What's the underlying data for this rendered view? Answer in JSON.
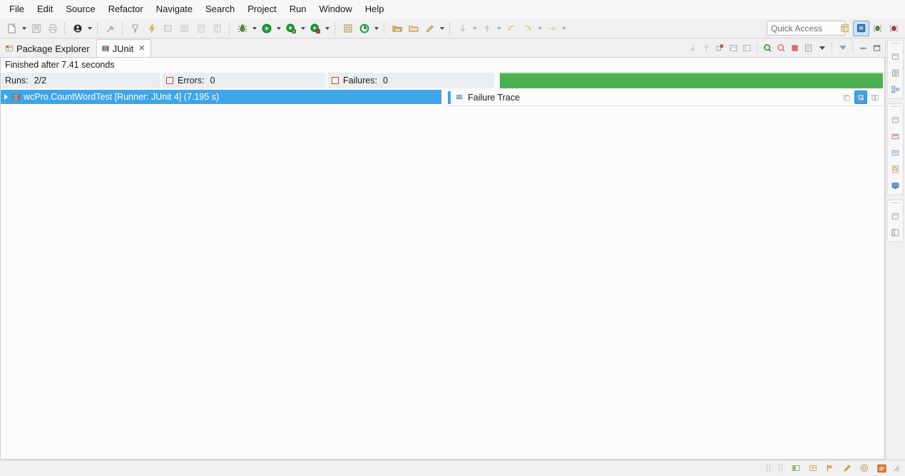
{
  "menubar": {
    "items": [
      {
        "label": "File",
        "name": "menu-file"
      },
      {
        "label": "Edit",
        "name": "menu-edit"
      },
      {
        "label": "Source",
        "name": "menu-source"
      },
      {
        "label": "Refactor",
        "name": "menu-refactor"
      },
      {
        "label": "Navigate",
        "name": "menu-navigate"
      },
      {
        "label": "Search",
        "name": "menu-search"
      },
      {
        "label": "Project",
        "name": "menu-project"
      },
      {
        "label": "Run",
        "name": "menu-run"
      },
      {
        "label": "Window",
        "name": "menu-window"
      },
      {
        "label": "Help",
        "name": "menu-help"
      }
    ]
  },
  "toolbar": {
    "quick_access_placeholder": "Quick Access",
    "icons": [
      "new-wizard-icon",
      "save-icon",
      "print-icon",
      "java-perspective-icon",
      "link-editor-icon",
      "new-annotation-icon",
      "build-icon",
      "external-tools-icon",
      "debug-icon",
      "run-icon",
      "run-as-icon",
      "coverage-icon",
      "new-java-class-icon",
      "new-java-package-icon",
      "open-type-icon",
      "search-icon",
      "open-task-icon",
      "bookmark-icon",
      "previous-annotation-icon",
      "next-annotation-icon",
      "back-icon",
      "forward-icon"
    ]
  },
  "perspective": {
    "items": [
      {
        "name": "open-perspective-icon",
        "active": false
      },
      {
        "name": "java-perspective-icon",
        "active": true
      },
      {
        "name": "debug-perspective-icon",
        "active": false
      },
      {
        "name": "java-ee-perspective-icon",
        "active": false
      }
    ]
  },
  "tabs": [
    {
      "label": "Package Explorer",
      "icon": "package-explorer-icon",
      "active": false,
      "closable": false
    },
    {
      "label": "JUnit",
      "icon": "junit-icon",
      "active": true,
      "closable": true,
      "close_glyph": "✕"
    }
  ],
  "view_toolbar": {
    "buttons": [
      {
        "name": "next-failed-test-icon",
        "title": "Next Failed Test"
      },
      {
        "name": "previous-failed-test-icon",
        "title": "Previous Failed Test"
      },
      {
        "name": "show-failures-only-icon",
        "title": "Show Failures Only"
      },
      {
        "name": "show-tests-in-hierarchy-icon",
        "title": "Show Tests in Hierarchy"
      },
      {
        "name": "scroll-lock-icon",
        "title": "Scroll Lock"
      },
      {
        "name": "rerun-test-icon",
        "title": "Rerun Test"
      },
      {
        "name": "rerun-failed-tests-icon",
        "title": "Rerun Test - Failures First"
      },
      {
        "name": "stop-test-run-icon",
        "title": "Stop JUnit Test Run"
      },
      {
        "name": "test-run-history-icon",
        "title": "Test Run History"
      },
      {
        "name": "view-menu-icon",
        "title": "View Menu"
      },
      {
        "name": "minimize-view-icon",
        "title": "Minimize"
      },
      {
        "name": "maximize-view-icon",
        "title": "Maximize"
      }
    ]
  },
  "junit": {
    "status_text": "Finished after 7.41 seconds",
    "counters": [
      {
        "name": "runs-counter",
        "label": "Runs:",
        "value": "2/2",
        "icon": null
      },
      {
        "name": "errors-counter",
        "label": "Errors:",
        "value": "0",
        "icon": "error-marker-icon"
      },
      {
        "name": "failures-counter",
        "label": "Failures:",
        "value": "0",
        "icon": "failure-marker-icon"
      }
    ],
    "progress": {
      "percent": 100,
      "color": "#4caf50",
      "state": "passed"
    },
    "tree": {
      "rows": [
        {
          "name": "test-suite-row",
          "label": "wcPro.CountWordTest [Runner: JUnit 4] (7.195 s)",
          "expanded": false,
          "selected": true,
          "icon": "test-suite-icon"
        }
      ]
    },
    "failure_trace": {
      "title": "Failure Trace",
      "icon": "failure-trace-icon",
      "buttons": [
        {
          "name": "copy-trace-icon",
          "active": false
        },
        {
          "name": "filter-stack-trace-icon",
          "active": true
        },
        {
          "name": "compare-result-icon",
          "active": false
        }
      ],
      "content": ""
    }
  },
  "fastview": {
    "groups": [
      {
        "name": "fastview-group-1",
        "items": [
          "package-explorer-icon",
          "outline-icon",
          "hierarchy-icon"
        ]
      },
      {
        "name": "fastview-group-2",
        "items": [
          "problems-icon",
          "servers-icon",
          "console-icon",
          "search-view-icon",
          "display-icon"
        ]
      },
      {
        "name": "fastview-group-3",
        "items": [
          "project-explorer-icon",
          "task-list-icon"
        ]
      }
    ]
  },
  "statusbar": {
    "text": "",
    "icons": [
      {
        "name": "smart-insert-icon"
      },
      {
        "name": "grid-icon"
      },
      {
        "name": "flag-icon"
      },
      {
        "name": "pencil-icon"
      },
      {
        "name": "at-icon"
      },
      {
        "name": "notification-icon"
      },
      {
        "name": "resize-grip-icon"
      }
    ]
  },
  "colors": {
    "accent_blue": "#3da5e8",
    "pass_green": "#4caf50",
    "error_red": "#cc3b3b",
    "chrome": "#f0f0f0"
  }
}
